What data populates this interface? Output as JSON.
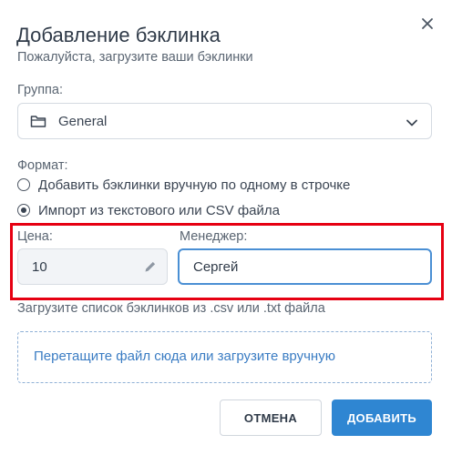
{
  "dialog": {
    "title": "Добавление бэклинка",
    "subtitle": "Пожалуйста, загрузите ваши бэклинки"
  },
  "group": {
    "label": "Группа:",
    "selected": "General",
    "icon": "folder-icon"
  },
  "format": {
    "label": "Формат:",
    "options": [
      {
        "label": "Добавить бэклинки вручную по одному в строчке",
        "checked": false
      },
      {
        "label": "Импорт из текстового или CSV файла",
        "checked": true
      }
    ]
  },
  "price": {
    "label": "Цена:",
    "value": "10",
    "icon": "pencil-icon"
  },
  "manager": {
    "label": "Менеджер:",
    "value": "Сергей"
  },
  "upload": {
    "hint": "Загрузите список бэклинков из .csv или .txt файла",
    "dropzone_text": "Перетащите файл сюда или загрузите вручную"
  },
  "buttons": {
    "cancel": "ОТМЕНА",
    "add": "ДОБАВИТЬ"
  },
  "colors": {
    "accent": "#2f86d2",
    "highlight": "#e60012",
    "link": "#3a7cc3"
  }
}
